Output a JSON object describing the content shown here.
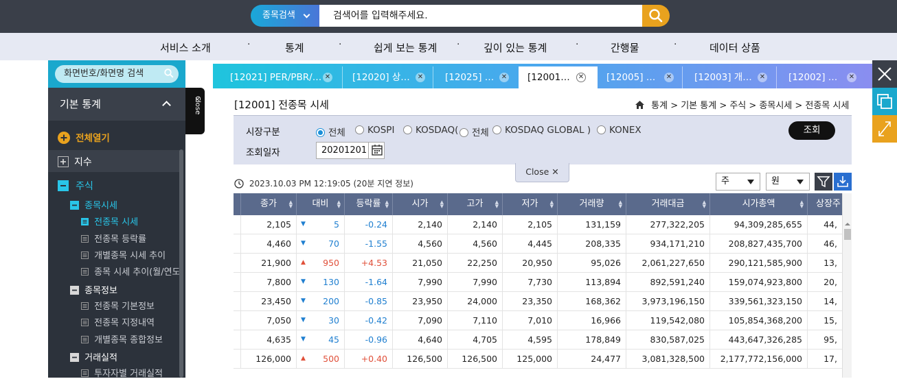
{
  "header": {
    "search_select": "종목검색",
    "search_placeholder": "검색어를 입력해주세요."
  },
  "gnb": [
    {
      "label": "서비스 소개"
    },
    {
      "label": "통계"
    },
    {
      "label": "쉽게 보는 통계"
    },
    {
      "label": "깊이 있는 통계"
    },
    {
      "label": "간행물"
    },
    {
      "label": "데이터 상품"
    }
  ],
  "gnb_sep": "·",
  "sidebar": {
    "search_placeholder": "화면번호/화면명 검색",
    "section_title": "기본 통계",
    "open_all": "전체열기",
    "items": [
      {
        "label": "지수",
        "level": 1,
        "state": "plus"
      },
      {
        "label": "주식",
        "level": 1,
        "state": "minus"
      },
      {
        "label": "종목시세",
        "level": 2,
        "state": "minus"
      },
      {
        "label": "전종목 시세",
        "level": 3,
        "state": "active"
      },
      {
        "label": "전종목 등락률",
        "level": 3,
        "state": "doc"
      },
      {
        "label": "개별종목 시세 추이",
        "level": 3,
        "state": "doc"
      },
      {
        "label": "종목 시세 추이(월/연도)",
        "level": 3,
        "state": "doc"
      },
      {
        "label": "종목정보",
        "level": 2,
        "state": "minus"
      },
      {
        "label": "전종목 기본정보",
        "level": 3,
        "state": "doc"
      },
      {
        "label": "전종목 지정내역",
        "level": 3,
        "state": "doc"
      },
      {
        "label": "개별종목 종합정보",
        "level": 3,
        "state": "doc"
      },
      {
        "label": "거래실적",
        "level": 2,
        "state": "minus"
      },
      {
        "label": "투자자별 거래실적",
        "level": 3,
        "state": "doc"
      }
    ],
    "close_label": "Close"
  },
  "tabs": [
    {
      "label": "[12021] PER/PBR/…",
      "active": false
    },
    {
      "label": "[12020] 상…",
      "active": false
    },
    {
      "label": "[12025] …",
      "active": false
    },
    {
      "label": "[12001…",
      "active": true
    },
    {
      "label": "[12005] …",
      "active": false
    },
    {
      "label": "[12003] 개…",
      "active": false
    },
    {
      "label": "[12002] …",
      "active": false
    }
  ],
  "page": {
    "title": "[12001] 전종목 시세",
    "breadcrumb": "통계 > 기본 통계 > 주식 > 종목시세 > 전종목 시세"
  },
  "filter": {
    "market_label": "시장구분",
    "date_label": "조회일자",
    "markets": [
      {
        "label": "전체",
        "checked": true
      },
      {
        "label": "KOSPI",
        "checked": false
      },
      {
        "label": "KOSDAQ(",
        "checked": false
      },
      {
        "label": "전체",
        "checked": false
      },
      {
        "label": "KOSDAQ GLOBAL )",
        "checked": false
      },
      {
        "label": "KONEX",
        "checked": false
      }
    ],
    "date_value": "20201201",
    "search_button": "조회",
    "close_label": "Close"
  },
  "timestamp": "2023.10.03 PM 12:19:05",
  "delay_note": "(20분 지연 정보)",
  "unit_select_1": "주",
  "unit_select_2": "원",
  "table": {
    "columns": [
      "종가",
      "대비",
      "등락률",
      "시가",
      "고가",
      "저가",
      "거래량",
      "거래대금",
      "시가총액",
      "상장주"
    ],
    "rows": [
      {
        "close": "2,105",
        "dir": "down",
        "diff": "5",
        "rate": "-0.24",
        "open": "2,140",
        "high": "2,140",
        "low": "2,105",
        "volume": "131,159",
        "value": "277,322,205",
        "mcap": "94,309,285,655",
        "shares": "44,"
      },
      {
        "close": "4,460",
        "dir": "down",
        "diff": "70",
        "rate": "-1.55",
        "open": "4,560",
        "high": "4,560",
        "low": "4,445",
        "volume": "208,335",
        "value": "934,171,210",
        "mcap": "208,827,435,700",
        "shares": "46,"
      },
      {
        "close": "21,900",
        "dir": "up",
        "diff": "950",
        "rate": "+4.53",
        "open": "21,050",
        "high": "22,250",
        "low": "20,950",
        "volume": "95,026",
        "value": "2,061,227,650",
        "mcap": "290,121,585,900",
        "shares": "13,"
      },
      {
        "close": "7,800",
        "dir": "down",
        "diff": "130",
        "rate": "-1.64",
        "open": "7,990",
        "high": "7,990",
        "low": "7,730",
        "volume": "113,894",
        "value": "892,591,240",
        "mcap": "159,074,923,800",
        "shares": "20,"
      },
      {
        "close": "23,450",
        "dir": "down",
        "diff": "200",
        "rate": "-0.85",
        "open": "23,950",
        "high": "24,000",
        "low": "23,350",
        "volume": "168,362",
        "value": "3,973,196,150",
        "mcap": "339,561,323,150",
        "shares": "14,"
      },
      {
        "close": "7,050",
        "dir": "down",
        "diff": "30",
        "rate": "-0.42",
        "open": "7,090",
        "high": "7,110",
        "low": "7,010",
        "volume": "16,966",
        "value": "119,542,080",
        "mcap": "105,854,368,200",
        "shares": "15,"
      },
      {
        "close": "4,635",
        "dir": "down",
        "diff": "45",
        "rate": "-0.96",
        "open": "4,640",
        "high": "4,705",
        "low": "4,595",
        "volume": "178,849",
        "value": "830,587,025",
        "mcap": "443,647,326,285",
        "shares": "95,"
      },
      {
        "close": "126,000",
        "dir": "up",
        "diff": "500",
        "rate": "+0.40",
        "open": "126,500",
        "high": "126,500",
        "low": "125,000",
        "volume": "24,477",
        "value": "3,081,328,500",
        "mcap": "2,177,772,156,000",
        "shares": "17,"
      }
    ]
  },
  "colors": {
    "accent": "#1aa8cd",
    "sidebar_bg": "#2c323b",
    "open_all": "#e9a21e",
    "tree_active": "#29c5e8",
    "up": "#e0503a",
    "down": "#1f7fd0",
    "header_bg": "#5a6a8c"
  },
  "icons": {
    "arrow_up": "▲",
    "arrow_down": "▼"
  }
}
